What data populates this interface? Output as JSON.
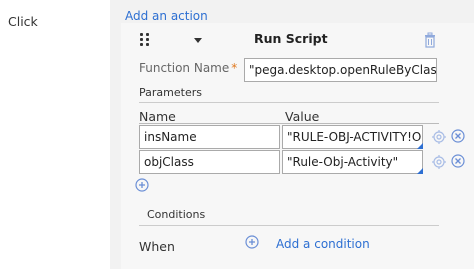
{
  "event": {
    "label": "Click"
  },
  "actions": {
    "add_action_label": "Add an action"
  },
  "action": {
    "name": "Run Script",
    "function_name_label": "Function Name",
    "required_marker": "*",
    "function_name_value": "\"pega.desktop.openRuleByClassA",
    "parameters_label": "Parameters",
    "columns": {
      "name": "Name",
      "value": "Value"
    },
    "params": [
      {
        "name": "insName",
        "value": "\"RULE-OBJ-ACTIVITY!ONE"
      },
      {
        "name": "objClass",
        "value": "\"Rule-Obj-Activity\""
      }
    ],
    "conditions_label": "Conditions",
    "when_label": "When",
    "add_condition_label": "Add a condition"
  },
  "colors": {
    "link": "#2d6fd2",
    "required": "#e0791e",
    "pane_bg": "#f2f2f2",
    "icon": "#6b8fd6"
  },
  "icons": {
    "drag": "drag-handle-icon",
    "chevron": "chevron-down-icon",
    "delete": "trash-icon",
    "param_action": "gear-target-icon",
    "param_remove": "remove-circle-icon",
    "add": "add-circle-icon"
  }
}
